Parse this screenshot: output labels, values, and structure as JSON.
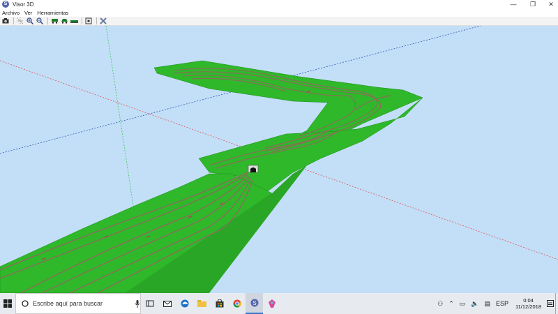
{
  "window": {
    "title": "Visor 3D",
    "controls": {
      "minimize": "—",
      "maximize": "❐",
      "close": "✕"
    }
  },
  "menu": {
    "items": [
      "Archivo",
      "Ver",
      "Herramientas"
    ]
  },
  "toolbar": {
    "buttons": [
      "camera-icon",
      "axes-icon",
      "zoom-in-icon",
      "zoom-out-icon",
      "train-icon",
      "train-alt-icon",
      "rail-icon",
      "fit-view-icon",
      "tools-icon"
    ]
  },
  "taskbar": {
    "search_placeholder": "Escribe aquí para buscar",
    "tray": {
      "language": "ESP",
      "time": "0:04",
      "date": "11/12/2018"
    }
  },
  "colors": {
    "sky": "#c3dff7",
    "terrain": "#2fb82a",
    "terrain_dark": "#1f8a1a",
    "rail": "#8a6e5a",
    "axis_red": "#e05050",
    "axis_blue": "#3050c0",
    "axis_green": "#3cbf5a"
  }
}
